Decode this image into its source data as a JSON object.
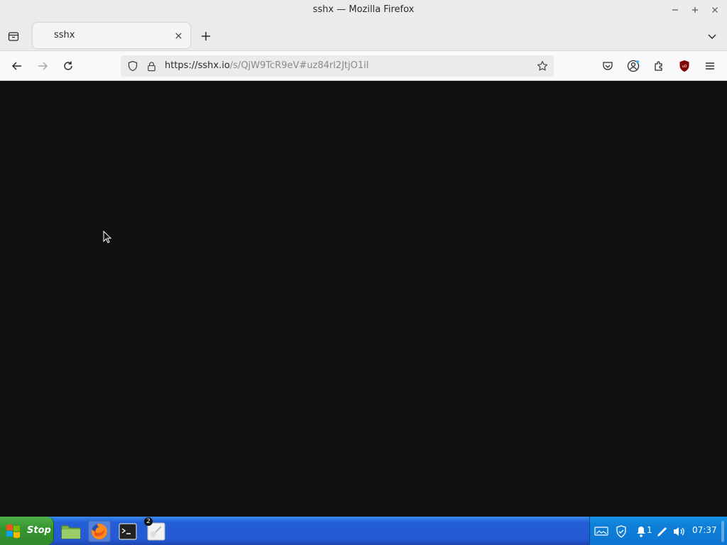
{
  "window": {
    "title": "sshx — Mozilla Firefox"
  },
  "tabs": [
    {
      "label": "sshx",
      "active": true
    }
  ],
  "navbar": {
    "url_host": "https://sshx.io",
    "url_path": "/s/QjW9TcR9eV#uz84rl2JtjO1il"
  },
  "taskbar": {
    "start_label": "Stop",
    "notification_badge": "2",
    "tray_count": "1",
    "clock": "07:37"
  },
  "colors": {
    "content_background": "#111111",
    "taskbar_blue": "#2459d2",
    "start_green": "#37952f",
    "tray_blue": "#0f7fd8"
  },
  "icons": [
    "list-all-tabs-icon",
    "close-tab-icon",
    "new-tab-icon",
    "tabs-dropdown-icon",
    "back-icon",
    "forward-icon",
    "reload-icon",
    "shield-icon",
    "lock-icon",
    "star-icon",
    "pocket-icon",
    "account-icon",
    "extensions-icon",
    "ublock-icon",
    "menu-icon",
    "windows-logo-icon",
    "file-manager-icon",
    "firefox-icon",
    "terminal-icon",
    "app-icon",
    "network-icon",
    "security-icon",
    "notification-icon",
    "pen-icon",
    "volume-icon"
  ]
}
